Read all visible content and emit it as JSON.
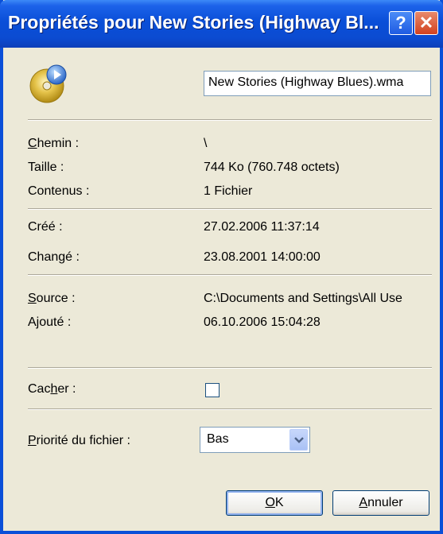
{
  "window": {
    "title": "Propriétés pour New Stories (Highway Bl...",
    "help_label": "?",
    "close_label": "✕"
  },
  "file": {
    "name": "New Stories (Highway Blues).wma",
    "icon": "cd-audio-icon"
  },
  "fields": {
    "path": {
      "label_first": "C",
      "label_rest": "hemin :",
      "value": "\\"
    },
    "size": {
      "label": "Taille :",
      "value": "744 Ko (760.748 octets)"
    },
    "contents": {
      "label": "Contenus :",
      "value": "1 Fichier"
    },
    "created": {
      "label": "Créé :",
      "value": "27.02.2006 11:37:14"
    },
    "modified": {
      "label": "Changé :",
      "value": "23.08.2001 14:00:00"
    },
    "source": {
      "label_first": "S",
      "label_rest": "ource :",
      "value": "C:\\Documents and Settings\\All Use"
    },
    "added": {
      "label": "Ajouté :",
      "value": "06.10.2006 15:04:28"
    },
    "hide": {
      "label_pre": "Cac",
      "label_u": "h",
      "label_post": "er :",
      "checked": false
    },
    "priority": {
      "label_first": "P",
      "label_rest": "riorité du fichier :",
      "value": "Bas"
    }
  },
  "buttons": {
    "ok_u": "O",
    "ok_rest": "K",
    "cancel_u": "A",
    "cancel_rest": "nnuler"
  },
  "colors": {
    "titlebar": "#0a4fd8",
    "face": "#ece9d8",
    "close": "#d2411f"
  }
}
